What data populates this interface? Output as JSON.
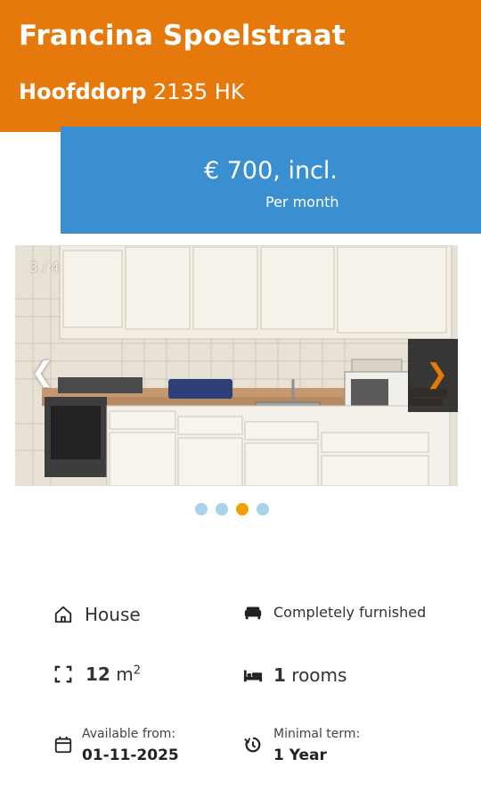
{
  "listing": {
    "street": "Francina Spoelstraat",
    "city": "Hoofddorp",
    "postcode": "2135 HK",
    "price": "€ 700, incl.",
    "price_period": "Per month"
  },
  "carousel": {
    "counter": "3 / 4",
    "prev_label": "❮",
    "next_label": "❯",
    "dots": [
      {
        "active": false
      },
      {
        "active": false
      },
      {
        "active": true
      },
      {
        "active": false
      }
    ],
    "current_index": 3,
    "total": 4
  },
  "features": {
    "type": {
      "icon": "house-icon",
      "label": "House"
    },
    "furnishing": {
      "icon": "sofa-icon",
      "label": "Completely furnished"
    },
    "area": {
      "icon": "area-icon",
      "value": "12",
      "unit": "m",
      "unit_sup": "2"
    },
    "rooms": {
      "icon": "bed-icon",
      "value": "1",
      "label": "rooms"
    },
    "available": {
      "icon": "calendar-icon",
      "caption": "Available from:",
      "value": "01-11-2025"
    },
    "term": {
      "icon": "timer-icon",
      "caption": "Minimal term:",
      "value": "1 Year"
    }
  },
  "colors": {
    "header": "#e5790b",
    "price_box": "#3a8fd1",
    "dot_inactive": "#a9d3ea",
    "dot_active": "#f0a000"
  }
}
